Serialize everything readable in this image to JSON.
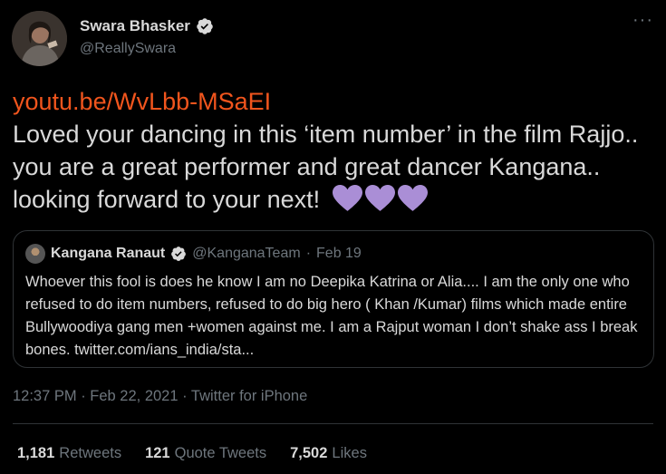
{
  "author": {
    "display_name": "Swara Bhasker",
    "handle": "@ReallySwara",
    "verified_icon": "verified-badge-icon"
  },
  "more_icon": "more-options-icon",
  "more_glyph": "···",
  "tweet": {
    "link": "youtu.be/WvLbb-MSaEI",
    "text": "Loved your dancing in this ‘item number’ in the film Rajjo.. you are a great performer and great dancer Kangana.. looking forward to your next!",
    "emoji": [
      "purple-heart-icon",
      "purple-heart-icon",
      "purple-heart-icon"
    ]
  },
  "quoted": {
    "display_name": "Kangana Ranaut",
    "handle": "@KanganaTeam",
    "separator": "·",
    "date": "Feb 19",
    "text": "Whoever this fool is does he know I am no Deepika Katrina or Alia.... I am the only one who refused to do item numbers, refused to do big hero ( Khan /Kumar) films which made entire Bullywoodiya gang men +women against me. I am a Rajput woman I don’t shake ass I break bones. twitter.com/ians_india/sta..."
  },
  "meta": {
    "time": "12:37 PM · Feb 22, 2021 · Twitter for iPhone"
  },
  "stats": {
    "retweets": {
      "count": "1,181",
      "label": "Retweets"
    },
    "quote_tweets": {
      "count": "121",
      "label": "Quote Tweets"
    },
    "likes": {
      "count": "7,502",
      "label": "Likes"
    }
  },
  "colors": {
    "background": "#000000",
    "text": "#d9d9d9",
    "muted": "#6e767d",
    "link": "#f1551d",
    "heart": "#aa8ed6",
    "border": "#2f3336"
  }
}
